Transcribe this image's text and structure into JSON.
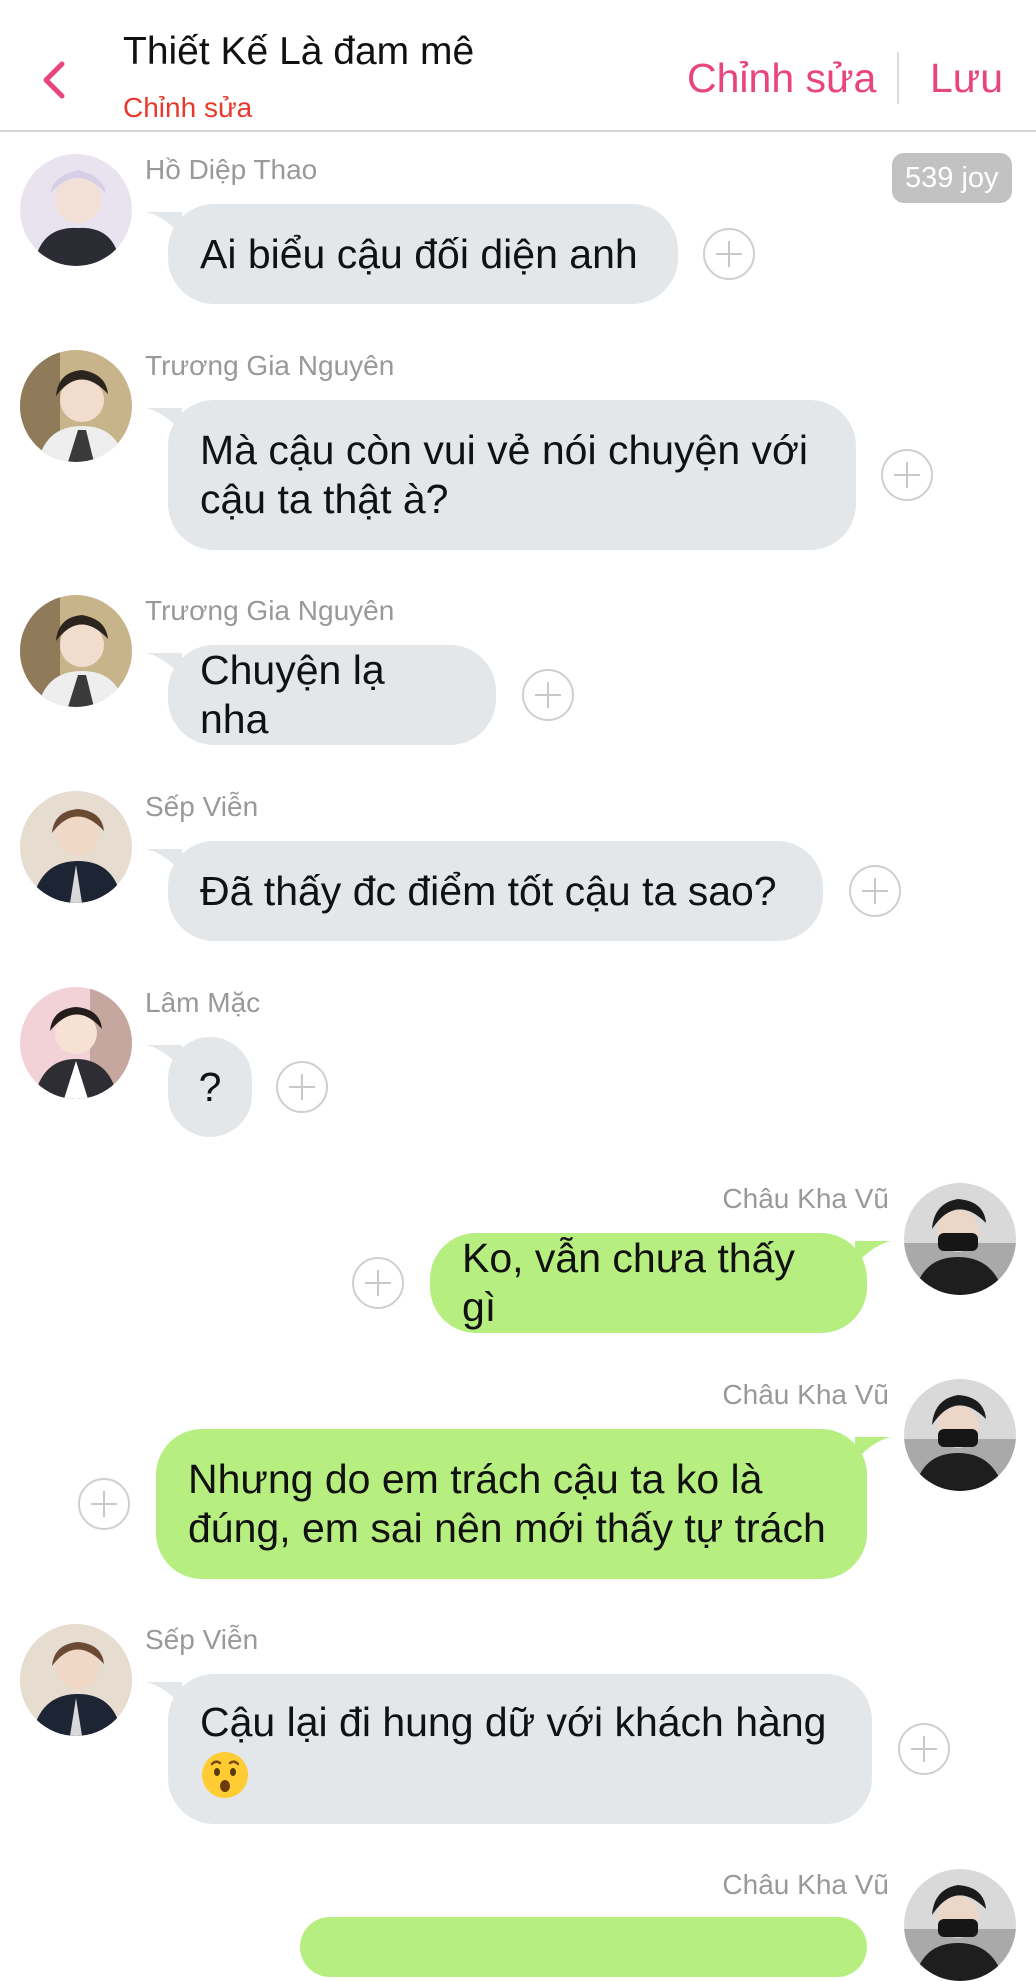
{
  "header": {
    "title": "Thiết Kế Là đam mê",
    "subtitle": "Chỉnh sửa",
    "edit_label": "Chỉnh sửa",
    "save_label": "Lưu",
    "accent_color": "#e8457a"
  },
  "badge": {
    "joy_label": "539 joy"
  },
  "messages": [
    {
      "sender": "Hồ Diệp Thao",
      "side": "left",
      "lines": [
        "Ai biểu cậu đối diện anh"
      ]
    },
    {
      "sender": "Trương Gia Nguyên",
      "side": "left",
      "lines": [
        "Mà cậu còn vui vẻ nói chuyện với",
        "cậu ta thật à?"
      ]
    },
    {
      "sender": "Trương Gia Nguyên",
      "side": "left",
      "lines": [
        "Chuyện lạ nha"
      ]
    },
    {
      "sender": "Sếp Viễn",
      "side": "left",
      "lines": [
        "Đã thấy đc điểm tốt cậu ta sao?"
      ]
    },
    {
      "sender": "Lâm Mặc",
      "side": "left",
      "lines": [
        "?"
      ]
    },
    {
      "sender": "Châu Kha Vũ",
      "side": "right",
      "lines": [
        "Ko, vẫn chưa thấy gì"
      ]
    },
    {
      "sender": "Châu Kha Vũ",
      "side": "right",
      "lines": [
        "Nhưng do em trách cậu ta ko là",
        "đúng, em sai nên mới thấy tự trách"
      ]
    },
    {
      "sender": "Sếp Viễn",
      "side": "left",
      "lines": [
        "Cậu lại đi hung dữ với khách hàng"
      ],
      "emoji": "astonished-face-icon"
    },
    {
      "sender": "Châu Kha Vũ",
      "side": "right",
      "lines": []
    }
  ],
  "colors": {
    "incoming_bubble": "#e4e7ea",
    "outgoing_bubble": "#b6ee80"
  }
}
